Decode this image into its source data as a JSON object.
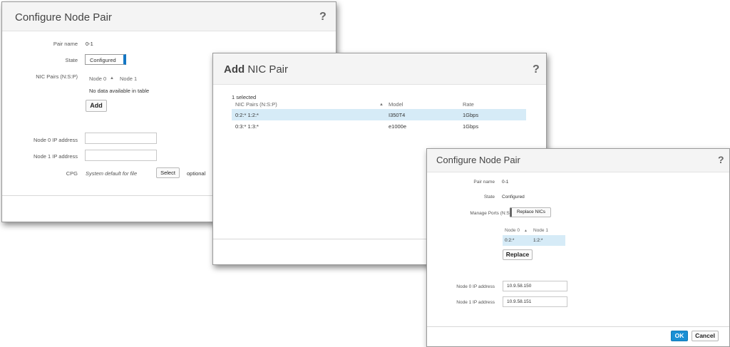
{
  "dialog1": {
    "title": "Configure Node Pair",
    "help": "?",
    "pair_name_label": "Pair name",
    "pair_name_value": "0-1",
    "state_label": "State",
    "state_value": "Configured",
    "nic_pairs_label": "NIC Pairs (N:S:P)",
    "table_headers": [
      "Node 0",
      "Node 1"
    ],
    "empty_text": "No data available in table",
    "add_label": "Add",
    "node0_ip_label": "Node 0 IP address",
    "node0_ip_value": "",
    "node1_ip_label": "Node 1 IP address",
    "node1_ip_value": "",
    "cpg_label": "CPG",
    "cpg_value": "System default for file",
    "select_label": "Select",
    "optional_text": "optional"
  },
  "dialog2": {
    "title_bold": "Add",
    "title_rest": " NIC Pair",
    "help": "?",
    "selected_text": "1 selected",
    "headers": [
      "NIC Pairs (N:S:P)",
      "Model",
      "Rate"
    ],
    "rows": [
      {
        "pairs": "0:2:* 1:2:*",
        "model": "I350T4",
        "rate": "1Gbps",
        "selected": true
      },
      {
        "pairs": "0:3:* 1:3:*",
        "model": "e1000e",
        "rate": "1Gbps",
        "selected": false
      }
    ]
  },
  "dialog3": {
    "title": "Configure Node Pair",
    "help": "?",
    "pair_name_label": "Pair name",
    "pair_name_value": "0-1",
    "state_label": "State",
    "state_value": "Configured",
    "manage_ports_label": "Manage Ports (N:S:P)",
    "replace_nics_label": "Replace NICs",
    "table_headers": [
      "Node 0",
      "Node 1"
    ],
    "table_row": [
      "0:2:*",
      "1:2:*"
    ],
    "replace_label": "Replace",
    "node0_ip_label": "Node 0 IP address",
    "node0_ip_value": "10.9.58.150",
    "node1_ip_label": "Node 1 IP address",
    "node1_ip_value": "10.9.58.151",
    "ok_label": "OK",
    "cancel_label": "Cancel"
  },
  "colors": {
    "accent": "#1477c4",
    "ok_button": "#1a8fd4",
    "selected_row": "#d6ebf7"
  }
}
